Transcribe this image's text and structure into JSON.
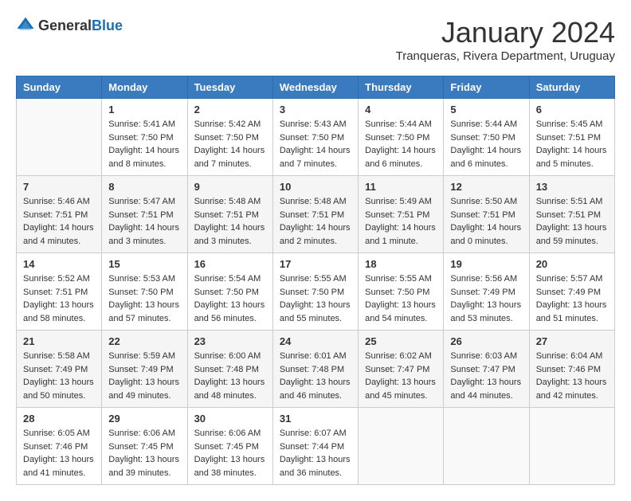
{
  "logo": {
    "general": "General",
    "blue": "Blue"
  },
  "title": "January 2024",
  "subtitle": "Tranqueras, Rivera Department, Uruguay",
  "days_of_week": [
    "Sunday",
    "Monday",
    "Tuesday",
    "Wednesday",
    "Thursday",
    "Friday",
    "Saturday"
  ],
  "weeks": [
    [
      {
        "day": "",
        "info": ""
      },
      {
        "day": "1",
        "info": "Sunrise: 5:41 AM\nSunset: 7:50 PM\nDaylight: 14 hours\nand 8 minutes."
      },
      {
        "day": "2",
        "info": "Sunrise: 5:42 AM\nSunset: 7:50 PM\nDaylight: 14 hours\nand 7 minutes."
      },
      {
        "day": "3",
        "info": "Sunrise: 5:43 AM\nSunset: 7:50 PM\nDaylight: 14 hours\nand 7 minutes."
      },
      {
        "day": "4",
        "info": "Sunrise: 5:44 AM\nSunset: 7:50 PM\nDaylight: 14 hours\nand 6 minutes."
      },
      {
        "day": "5",
        "info": "Sunrise: 5:44 AM\nSunset: 7:50 PM\nDaylight: 14 hours\nand 6 minutes."
      },
      {
        "day": "6",
        "info": "Sunrise: 5:45 AM\nSunset: 7:51 PM\nDaylight: 14 hours\nand 5 minutes."
      }
    ],
    [
      {
        "day": "7",
        "info": "Sunrise: 5:46 AM\nSunset: 7:51 PM\nDaylight: 14 hours\nand 4 minutes."
      },
      {
        "day": "8",
        "info": "Sunrise: 5:47 AM\nSunset: 7:51 PM\nDaylight: 14 hours\nand 3 minutes."
      },
      {
        "day": "9",
        "info": "Sunrise: 5:48 AM\nSunset: 7:51 PM\nDaylight: 14 hours\nand 3 minutes."
      },
      {
        "day": "10",
        "info": "Sunrise: 5:48 AM\nSunset: 7:51 PM\nDaylight: 14 hours\nand 2 minutes."
      },
      {
        "day": "11",
        "info": "Sunrise: 5:49 AM\nSunset: 7:51 PM\nDaylight: 14 hours\nand 1 minute."
      },
      {
        "day": "12",
        "info": "Sunrise: 5:50 AM\nSunset: 7:51 PM\nDaylight: 14 hours\nand 0 minutes."
      },
      {
        "day": "13",
        "info": "Sunrise: 5:51 AM\nSunset: 7:51 PM\nDaylight: 13 hours\nand 59 minutes."
      }
    ],
    [
      {
        "day": "14",
        "info": "Sunrise: 5:52 AM\nSunset: 7:51 PM\nDaylight: 13 hours\nand 58 minutes."
      },
      {
        "day": "15",
        "info": "Sunrise: 5:53 AM\nSunset: 7:50 PM\nDaylight: 13 hours\nand 57 minutes."
      },
      {
        "day": "16",
        "info": "Sunrise: 5:54 AM\nSunset: 7:50 PM\nDaylight: 13 hours\nand 56 minutes."
      },
      {
        "day": "17",
        "info": "Sunrise: 5:55 AM\nSunset: 7:50 PM\nDaylight: 13 hours\nand 55 minutes."
      },
      {
        "day": "18",
        "info": "Sunrise: 5:55 AM\nSunset: 7:50 PM\nDaylight: 13 hours\nand 54 minutes."
      },
      {
        "day": "19",
        "info": "Sunrise: 5:56 AM\nSunset: 7:49 PM\nDaylight: 13 hours\nand 53 minutes."
      },
      {
        "day": "20",
        "info": "Sunrise: 5:57 AM\nSunset: 7:49 PM\nDaylight: 13 hours\nand 51 minutes."
      }
    ],
    [
      {
        "day": "21",
        "info": "Sunrise: 5:58 AM\nSunset: 7:49 PM\nDaylight: 13 hours\nand 50 minutes."
      },
      {
        "day": "22",
        "info": "Sunrise: 5:59 AM\nSunset: 7:49 PM\nDaylight: 13 hours\nand 49 minutes."
      },
      {
        "day": "23",
        "info": "Sunrise: 6:00 AM\nSunset: 7:48 PM\nDaylight: 13 hours\nand 48 minutes."
      },
      {
        "day": "24",
        "info": "Sunrise: 6:01 AM\nSunset: 7:48 PM\nDaylight: 13 hours\nand 46 minutes."
      },
      {
        "day": "25",
        "info": "Sunrise: 6:02 AM\nSunset: 7:47 PM\nDaylight: 13 hours\nand 45 minutes."
      },
      {
        "day": "26",
        "info": "Sunrise: 6:03 AM\nSunset: 7:47 PM\nDaylight: 13 hours\nand 44 minutes."
      },
      {
        "day": "27",
        "info": "Sunrise: 6:04 AM\nSunset: 7:46 PM\nDaylight: 13 hours\nand 42 minutes."
      }
    ],
    [
      {
        "day": "28",
        "info": "Sunrise: 6:05 AM\nSunset: 7:46 PM\nDaylight: 13 hours\nand 41 minutes."
      },
      {
        "day": "29",
        "info": "Sunrise: 6:06 AM\nSunset: 7:45 PM\nDaylight: 13 hours\nand 39 minutes."
      },
      {
        "day": "30",
        "info": "Sunrise: 6:06 AM\nSunset: 7:45 PM\nDaylight: 13 hours\nand 38 minutes."
      },
      {
        "day": "31",
        "info": "Sunrise: 6:07 AM\nSunset: 7:44 PM\nDaylight: 13 hours\nand 36 minutes."
      },
      {
        "day": "",
        "info": ""
      },
      {
        "day": "",
        "info": ""
      },
      {
        "day": "",
        "info": ""
      }
    ]
  ]
}
